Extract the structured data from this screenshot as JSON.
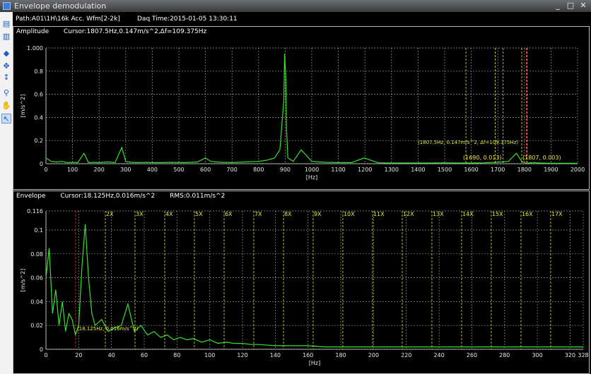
{
  "window": {
    "title": "Envelope demodulation",
    "btn_min": "_",
    "btn_max": "□",
    "btn_close": "✕"
  },
  "toolbar": {
    "tools": [
      "chart-icon",
      "chart-alt-icon",
      "marker-icon",
      "move-icon",
      "expand-icon",
      "zoom-icon",
      "pan-icon",
      "pointer-icon"
    ]
  },
  "info": {
    "path": "Path:A01\\1H\\16k Acc. Wfm[2-2k]",
    "daq_time": "Daq Time:2015-01-05 13:30:11"
  },
  "amplitude_panel": {
    "title": "Amplitude",
    "cursor": "Cursor:1807.5Hz,0.147m/s^2,Δf=109.375Hz",
    "annotations": [
      "(1807.5Hz, 0.147m/s^2, Δf=109.375Hz)",
      "(1690, 0.013)",
      "(1807, 0.003)"
    ]
  },
  "envelope_panel": {
    "title": "Envelope",
    "cursor": "Cursor:18.125Hz,0.016m/s^2",
    "rms": "RMS:0.011m/s^2",
    "annotation": "(18.125Hz, 0.016m/s^2)"
  },
  "chart_data": [
    {
      "type": "line",
      "title": "Amplitude",
      "xlabel": "[Hz]",
      "ylabel": "[m/s^2]",
      "xlim": [
        0,
        2000
      ],
      "ylim": [
        0,
        1.0
      ],
      "xticks": [
        "0",
        "100",
        "200",
        "300",
        "400",
        "500",
        "600",
        "700",
        "800",
        "900",
        "1000",
        "1100",
        "1200",
        "1300",
        "1400",
        "1500",
        "1600",
        "1700",
        "1800",
        "1900",
        "2000"
      ],
      "yticks": [
        "0",
        "0.2",
        "0.4",
        "0.6",
        "0.8",
        "1.000"
      ],
      "series": [
        {
          "color": "#35e02b",
          "x": [
            0,
            20,
            40,
            60,
            80,
            100,
            120,
            143,
            160,
            180,
            200,
            230,
            260,
            285,
            300,
            320,
            350,
            380,
            400,
            430,
            470,
            520,
            570,
            600,
            620,
            660,
            700,
            750,
            800,
            830,
            860,
            880,
            895,
            898,
            902,
            905,
            910,
            930,
            960,
            1000,
            1050,
            1100,
            1150,
            1197,
            1250,
            1300,
            1350,
            1400,
            1450,
            1500,
            1550,
            1600,
            1650,
            1700,
            1740,
            1770,
            1790,
            1807,
            1830,
            1860,
            1900,
            1950,
            2000
          ],
          "y": [
            0.05,
            0.02,
            0.015,
            0.02,
            0.01,
            0.012,
            0.01,
            0.09,
            0.01,
            0.012,
            0.01,
            0.015,
            0.01,
            0.14,
            0.02,
            0.012,
            0.01,
            0.012,
            0.01,
            0.01,
            0.012,
            0.01,
            0.015,
            0.05,
            0.02,
            0.012,
            0.01,
            0.015,
            0.02,
            0.03,
            0.05,
            0.12,
            0.55,
            0.95,
            0.75,
            0.3,
            0.05,
            0.02,
            0.12,
            0.02,
            0.012,
            0.01,
            0.01,
            0.05,
            0.008,
            0.006,
            0.006,
            0.006,
            0.006,
            0.008,
            0.006,
            0.006,
            0.008,
            0.013,
            0.02,
            0.09,
            0.02,
            0.003,
            0.01,
            0.006,
            0.004,
            0.004,
            0.004
          ]
        }
      ],
      "markers": {
        "red_cursor_hz": 1807.5,
        "yellow_lines_hz": [
          1580,
          1690,
          1720,
          1790,
          1810
        ]
      },
      "grid": true
    },
    {
      "type": "line",
      "title": "Envelope",
      "xlabel": "[Hz]",
      "ylabel": "[m/s^2]",
      "xlim": [
        0,
        328
      ],
      "ylim": [
        0,
        0.116
      ],
      "xticks": [
        "0",
        "20",
        "40",
        "60",
        "80",
        "100",
        "120",
        "140",
        "160",
        "180",
        "200",
        "220",
        "240",
        "260",
        "280",
        "300",
        "320",
        "328"
      ],
      "yticks": [
        "0",
        "0.02",
        "0.04",
        "0.06",
        "0.08",
        "0.1",
        "0.116"
      ],
      "harmonics": [
        "2X",
        "3X",
        "4X",
        "5X",
        "6X",
        "7X",
        "8X",
        "9X",
        "10X",
        "11X",
        "12X",
        "13X",
        "14X",
        "15X",
        "16X",
        "17X"
      ],
      "series": [
        {
          "color": "#35e02b",
          "x": [
            0,
            2,
            4,
            6,
            8,
            10,
            12,
            14,
            16,
            18,
            20,
            22,
            24,
            26,
            28,
            30,
            34,
            38,
            42,
            46,
            50,
            54,
            58,
            62,
            66,
            70,
            74,
            78,
            82,
            86,
            90,
            95,
            100,
            105,
            110,
            115,
            120,
            125,
            130,
            140,
            150,
            160,
            170,
            180,
            190,
            200,
            210,
            220,
            230,
            240,
            250,
            260,
            270,
            280,
            290,
            300,
            310,
            320,
            328
          ],
          "y": [
            0.06,
            0.085,
            0.03,
            0.05,
            0.02,
            0.04,
            0.015,
            0.03,
            0.025,
            0.012,
            0.02,
            0.07,
            0.105,
            0.06,
            0.03,
            0.02,
            0.025,
            0.015,
            0.018,
            0.02,
            0.038,
            0.015,
            0.02,
            0.012,
            0.015,
            0.01,
            0.012,
            0.008,
            0.01,
            0.008,
            0.009,
            0.006,
            0.008,
            0.005,
            0.006,
            0.005,
            0.005,
            0.004,
            0.004,
            0.003,
            0.003,
            0.003,
            0.002,
            0.002,
            0.002,
            0.002,
            0.002,
            0.002,
            0.002,
            0.002,
            0.002,
            0.002,
            0.002,
            0.002,
            0.002,
            0.002,
            0.002,
            0.002,
            0.002
          ]
        }
      ],
      "markers": {
        "red_cursor_hz": 18.125,
        "harmonic_base_hz": 18.125
      },
      "grid": true
    }
  ]
}
